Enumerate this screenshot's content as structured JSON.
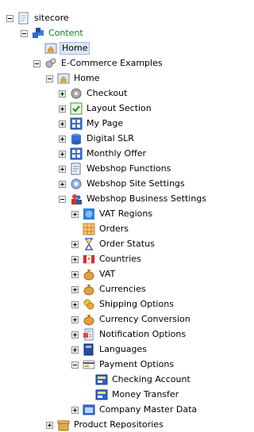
{
  "tree": {
    "root": "sitecore",
    "content": "Content",
    "home_top": "Home",
    "ecommerce_examples": "E-Commerce Examples",
    "home_sub": "Home",
    "items": [
      "Checkout",
      "Layout Section",
      "My Page",
      "Digital SLR",
      "Monthly Offer",
      "Webshop Functions",
      "Webshop Site Settings",
      "Webshop Business Settings"
    ],
    "business_children": [
      "VAT Regions",
      "Orders",
      "Order Status",
      "Countries",
      "VAT",
      "Currencies",
      "Shipping Options",
      "Currency Conversion",
      "Notification Options",
      "Languages",
      "Payment Options"
    ],
    "payment_children": [
      "Checking Account",
      "Money Transfer"
    ],
    "company_master_data": "Company Master Data",
    "product_repositories": "Product Repositories"
  }
}
